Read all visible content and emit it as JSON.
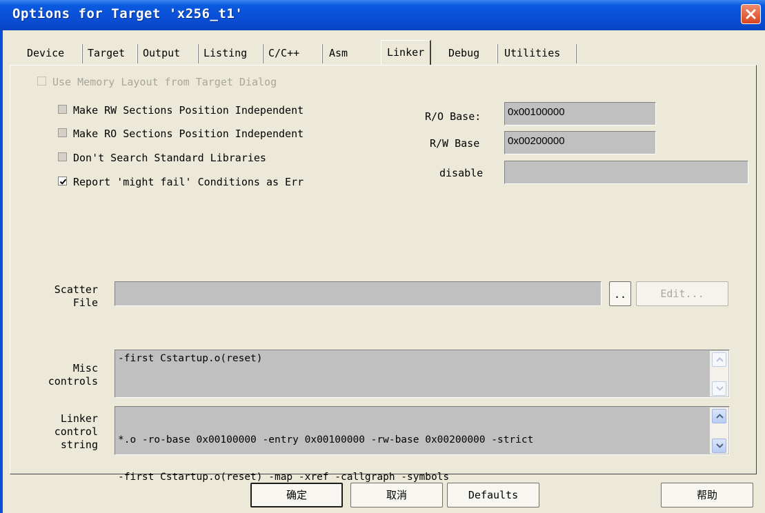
{
  "window": {
    "title": "Options for Target 'x256_t1'"
  },
  "tabs": [
    {
      "label": "Device"
    },
    {
      "label": "Target"
    },
    {
      "label": "Output"
    },
    {
      "label": "Listing"
    },
    {
      "label": "C/C++"
    },
    {
      "label": "Asm"
    },
    {
      "label": "Linker",
      "selected": true
    },
    {
      "label": "Debug"
    },
    {
      "label": "Utilities"
    }
  ],
  "linker": {
    "use_memory_layout": {
      "label": "Use Memory Layout from Target Dialog",
      "checked": false,
      "enabled": false
    },
    "options": [
      {
        "label": "Make RW Sections Position Independent",
        "checked": false
      },
      {
        "label": "Make RO Sections Position Independent",
        "checked": false
      },
      {
        "label": "Don't Search Standard Libraries",
        "checked": false
      },
      {
        "label": "Report 'might fail' Conditions as Err",
        "checked": true
      }
    ],
    "ro_base": {
      "label": "R/O Base:",
      "value": "0x00100000"
    },
    "rw_base": {
      "label": "R/W Base",
      "value": "0x00200000"
    },
    "disable": {
      "label": "disable",
      "value": ""
    },
    "scatter_file": {
      "label_line1": "Scatter",
      "label_line2": "File",
      "value": "",
      "browse_label": "..",
      "edit_label": "Edit..."
    },
    "misc_controls": {
      "label_line1": "Misc",
      "label_line2": "controls",
      "value": "-first Cstartup.o(reset)"
    },
    "linker_control": {
      "label_line1": "Linker",
      "label_line2": "control",
      "label_line3": "string",
      "line1": "*.o -ro-base 0x00100000 -entry 0x00100000 -rw-base 0x00200000 -strict",
      "line2": "-first Cstartup.o(reset) -map -xref -callgraph -symbols"
    }
  },
  "buttons": {
    "ok": "确定",
    "cancel": "取消",
    "defaults": "Defaults",
    "help": "帮助"
  },
  "colors": {
    "titlebar": "#0a4fd6",
    "dialog_bg": "#ece9d8",
    "field_bg": "#c0c0c0",
    "close_button": "#d9451f"
  }
}
